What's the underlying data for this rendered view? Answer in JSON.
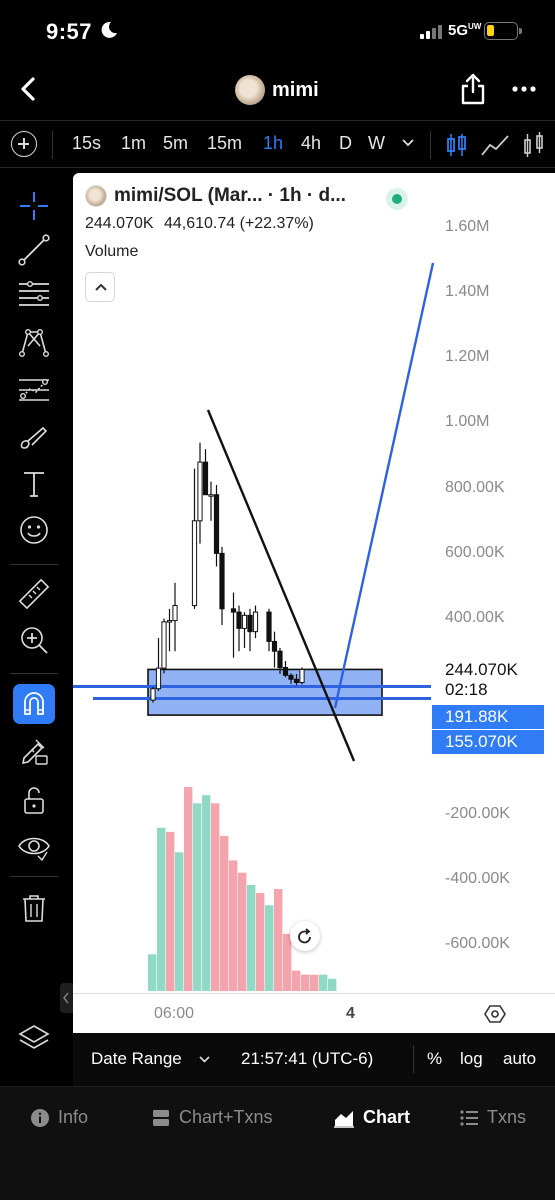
{
  "status_bar": {
    "time": "9:57",
    "network": "5G",
    "network_suffix": "UW"
  },
  "header": {
    "title": "mimi"
  },
  "timeframes": {
    "items": [
      "15s",
      "1m",
      "5m",
      "15m",
      "1h",
      "4h",
      "D",
      "W"
    ],
    "active": "1h"
  },
  "legend": {
    "symbol": "mimi/SOL (Mar... · 1h · d...",
    "price": "244.070K",
    "change_abs": "44,610.74",
    "change_pct": "(+22.37%)",
    "volume_label": "Volume"
  },
  "y_axis": {
    "labels": [
      "1.60M",
      "1.40M",
      "1.20M",
      "1.00M",
      "800.00K",
      "600.00K",
      "400.00K",
      "-200.00K",
      "-400.00K",
      "-600.00K"
    ]
  },
  "price_marks": {
    "current_price": "244.070K",
    "countdown": "02:18",
    "line_tag_1": "191.88K",
    "line_tag_2": "155.070K"
  },
  "x_axis": {
    "labels": [
      "06:00",
      "4"
    ]
  },
  "chart_bottom_bar": {
    "date_range": "Date Range",
    "clock": "21:57:41 (UTC-6)",
    "percent": "%",
    "log": "log",
    "auto": "auto"
  },
  "bottom_nav": {
    "items": [
      "Info",
      "Chart+Txns",
      "Chart",
      "Txns"
    ],
    "active": "Chart"
  },
  "colors": {
    "accent_blue": "#2f7cf6",
    "up_volume": "#8fd9c6",
    "down_volume": "#f4a4ad",
    "live_green": "#1fae82"
  },
  "chart_data": {
    "type": "candlestick",
    "interval": "1h",
    "price_unit": "market cap",
    "candles": [
      {
        "o": 150000,
        "h": 190000,
        "l": 142000,
        "c": 185000
      },
      {
        "o": 185000,
        "h": 340000,
        "l": 178000,
        "c": 248000
      },
      {
        "o": 248000,
        "h": 400000,
        "l": 232000,
        "c": 390000
      },
      {
        "o": 390000,
        "h": 430000,
        "l": 300000,
        "c": 394000
      },
      {
        "o": 394000,
        "h": 510000,
        "l": 300000,
        "c": 440000
      },
      {
        "o": 440000,
        "h": 860000,
        "l": 430000,
        "c": 700000
      },
      {
        "o": 700000,
        "h": 940000,
        "l": 630000,
        "c": 880000
      },
      {
        "o": 880000,
        "h": 920000,
        "l": 780000,
        "c": 780000
      },
      {
        "o": 780000,
        "h": 820000,
        "l": 700000,
        "c": 780000
      },
      {
        "o": 780000,
        "h": 810000,
        "l": 560000,
        "c": 600000
      },
      {
        "o": 600000,
        "h": 620000,
        "l": 380000,
        "c": 430000
      },
      {
        "o": 430000,
        "h": 480000,
        "l": 280000,
        "c": 420000
      },
      {
        "o": 420000,
        "h": 440000,
        "l": 300000,
        "c": 370000
      },
      {
        "o": 370000,
        "h": 420000,
        "l": 310000,
        "c": 410000
      },
      {
        "o": 410000,
        "h": 430000,
        "l": 300000,
        "c": 360000
      },
      {
        "o": 360000,
        "h": 440000,
        "l": 340000,
        "c": 420000
      },
      {
        "o": 420000,
        "h": 430000,
        "l": 300000,
        "c": 330000
      },
      {
        "o": 330000,
        "h": 360000,
        "l": 250000,
        "c": 300000
      },
      {
        "o": 300000,
        "h": 310000,
        "l": 230000,
        "c": 250000
      },
      {
        "o": 250000,
        "h": 270000,
        "l": 220000,
        "c": 226000
      },
      {
        "o": 226000,
        "h": 232000,
        "l": 200000,
        "c": 214000
      },
      {
        "o": 214000,
        "h": 230000,
        "l": 196000,
        "c": 204000
      },
      {
        "o": 204000,
        "h": 250000,
        "l": 198000,
        "c": 244070
      }
    ],
    "volume": [
      {
        "v": 18,
        "up": true
      },
      {
        "v": 80,
        "up": true
      },
      {
        "v": 78,
        "up": false
      },
      {
        "v": 68,
        "up": true
      },
      {
        "v": 100,
        "up": false
      },
      {
        "v": 92,
        "up": true
      },
      {
        "v": 96,
        "up": true
      },
      {
        "v": 92,
        "up": false
      },
      {
        "v": 76,
        "up": false
      },
      {
        "v": 64,
        "up": false
      },
      {
        "v": 58,
        "up": false
      },
      {
        "v": 52,
        "up": true
      },
      {
        "v": 48,
        "up": false
      },
      {
        "v": 42,
        "up": true
      },
      {
        "v": 50,
        "up": false
      },
      {
        "v": 28,
        "up": false
      },
      {
        "v": 10,
        "up": false
      },
      {
        "v": 8,
        "up": false
      },
      {
        "v": 8,
        "up": false
      },
      {
        "v": 8,
        "up": true
      },
      {
        "v": 6,
        "up": true
      }
    ],
    "drawings": {
      "trendline_black": {
        "from": [
          1,
          1040000
        ],
        "to": [
          3,
          -120000
        ]
      },
      "trendline_blue": {
        "from": [
          2,
          120000
        ],
        "to": [
          5,
          1500000
        ]
      },
      "box": {
        "top": 244070,
        "bottom": 104000
      },
      "hline_1": 191880,
      "hline_2": 155070
    },
    "ylim": [
      -650000,
      1650000
    ]
  }
}
